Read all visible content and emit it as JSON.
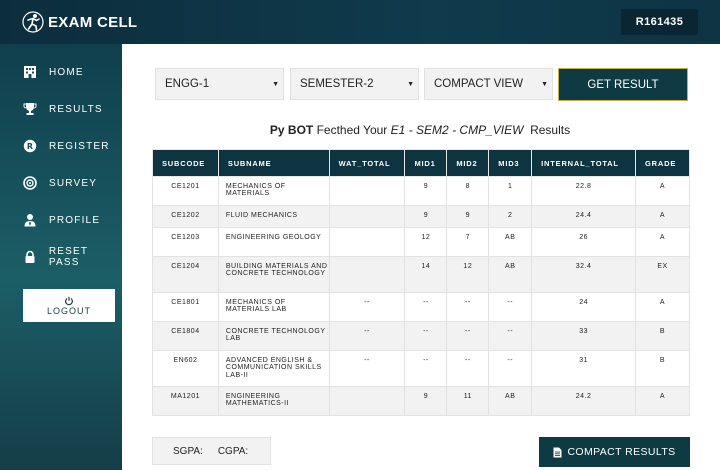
{
  "header": {
    "app_title": "EXAM CELL",
    "user_id": "R161435"
  },
  "sidebar": {
    "items": [
      {
        "label": "HOME",
        "icon": "building-icon"
      },
      {
        "label": "RESULTS",
        "icon": "trophy-icon"
      },
      {
        "label": "REGISTER",
        "icon": "registered-icon"
      },
      {
        "label": "SURVEY",
        "icon": "target-icon"
      },
      {
        "label": "PROFILE",
        "icon": "user-tie-icon"
      },
      {
        "label": "RESET PASS",
        "icon": "lock-icon"
      }
    ],
    "logout_label": "LOGOUT"
  },
  "filters": {
    "year": "ENGG-1",
    "semester": "SEMESTER-2",
    "view": "COMPACT VIEW",
    "get_result_label": "GET RESULT"
  },
  "result_caption": {
    "bot": "Py BOT",
    "text1": "Fecthed Your",
    "year": "E1",
    "sep1": "-",
    "sem": "SEM2",
    "sep2": "-",
    "view": "CMP_VIEW",
    "text2": "Results"
  },
  "table": {
    "headers": [
      "SUBCODE",
      "SUBNAME",
      "WAT_TOTAL",
      "MID1",
      "MID2",
      "MID3",
      "INTERNAL_TOTAL",
      "GRADE"
    ],
    "rows": [
      [
        "CE1201",
        "MECHANICS OF MATERIALS",
        "",
        "9",
        "8",
        "1",
        "22.8",
        "A"
      ],
      [
        "CE1202",
        "FLUID MECHANICS",
        "",
        "9",
        "9",
        "2",
        "24.4",
        "A"
      ],
      [
        "CE1203",
        "ENGINEERING GEOLOGY",
        "",
        "12",
        "7",
        "AB",
        "26",
        "A"
      ],
      [
        "CE1204",
        "BUILDING MATERIALS AND CONCRETE TECHNOLOGY",
        "",
        "14",
        "12",
        "AB",
        "32.4",
        "EX"
      ],
      [
        "CE1801",
        "MECHANICS OF MATERIALS LAB",
        "--",
        "--",
        "--",
        "--",
        "24",
        "A"
      ],
      [
        "CE1804",
        "CONCRETE TECHNOLOGY LAB",
        "--",
        "--",
        "--",
        "--",
        "33",
        "B"
      ],
      [
        "EN602",
        "ADVANCED ENGLISH & COMMUNICATION SKILLS LAB-II",
        "--",
        "--",
        "--",
        "--",
        "31",
        "B"
      ],
      [
        "MA1201",
        "ENGINEERING MATHEMATICS-II",
        "",
        "9",
        "11",
        "AB",
        "24.2",
        "A"
      ]
    ]
  },
  "footer": {
    "sgpa_label": "SGPA:",
    "cgpa_label": "CGPA:",
    "compact_results_label": "COMPACT RESULTS"
  }
}
